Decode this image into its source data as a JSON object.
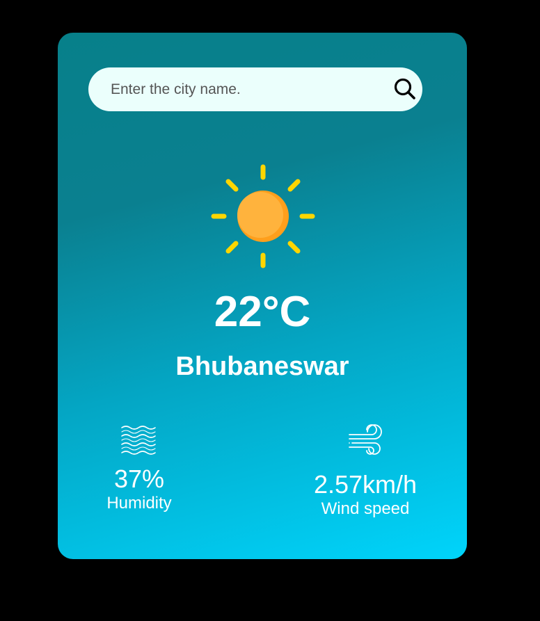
{
  "search": {
    "placeholder": "Enter the city name.",
    "value": "",
    "icon": "search-icon"
  },
  "weather": {
    "icon": "sun-icon",
    "temperature": "22°C",
    "city": "Bhubaneswar"
  },
  "details": {
    "humidity": {
      "icon": "humidity-waves-icon",
      "value": "37%",
      "label": "Humidity"
    },
    "wind": {
      "icon": "wind-icon",
      "value": "2.57km/h",
      "label": "Wind speed"
    }
  },
  "colors": {
    "page_background": "#000000",
    "card_gradient_start": "#07808a",
    "card_gradient_end": "#00d4fb",
    "search_background": "#ebfffc",
    "sun_body": "#ffae3d",
    "sun_rays": "#ffd600"
  }
}
